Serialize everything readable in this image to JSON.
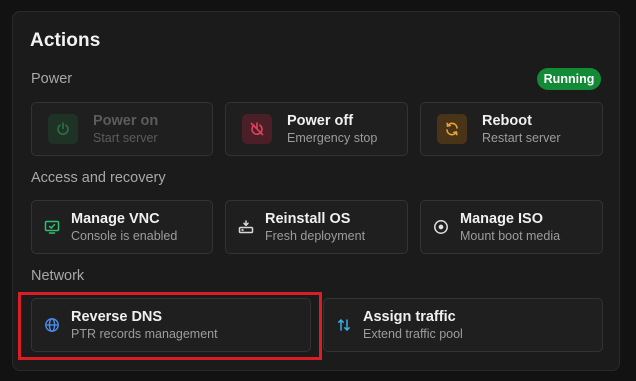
{
  "title": "Actions",
  "sections": {
    "power": {
      "label": "Power"
    },
    "access": {
      "label": "Access and recovery"
    },
    "network": {
      "label": "Network"
    }
  },
  "status_badge": {
    "text": "Running",
    "color": "#138a36"
  },
  "cards": {
    "power_on": {
      "title": "Power on",
      "subtitle": "Start server",
      "icon": "power-icon",
      "enabled": false
    },
    "power_off": {
      "title": "Power off",
      "subtitle": "Emergency stop",
      "icon": "power-off-icon",
      "accent": "#e0415a"
    },
    "reboot": {
      "title": "Reboot",
      "subtitle": "Restart server",
      "icon": "refresh-icon",
      "accent": "#e9a23b"
    },
    "manage_vnc": {
      "title": "Manage VNC",
      "subtitle": "Console is enabled",
      "icon": "monitor-icon",
      "accent": "#2fbf71"
    },
    "reinstall_os": {
      "title": "Reinstall OS",
      "subtitle": "Fresh deployment",
      "icon": "drive-icon"
    },
    "manage_iso": {
      "title": "Manage ISO",
      "subtitle": "Mount boot media",
      "icon": "disc-icon"
    },
    "reverse_dns": {
      "title": "Reverse DNS",
      "subtitle": "PTR records management",
      "icon": "globe-icon",
      "accent": "#4a8cf0"
    },
    "assign_traffic": {
      "title": "Assign traffic",
      "subtitle": "Extend traffic pool",
      "icon": "swap-vertical-icon",
      "accent": "#3bb0e0"
    }
  }
}
